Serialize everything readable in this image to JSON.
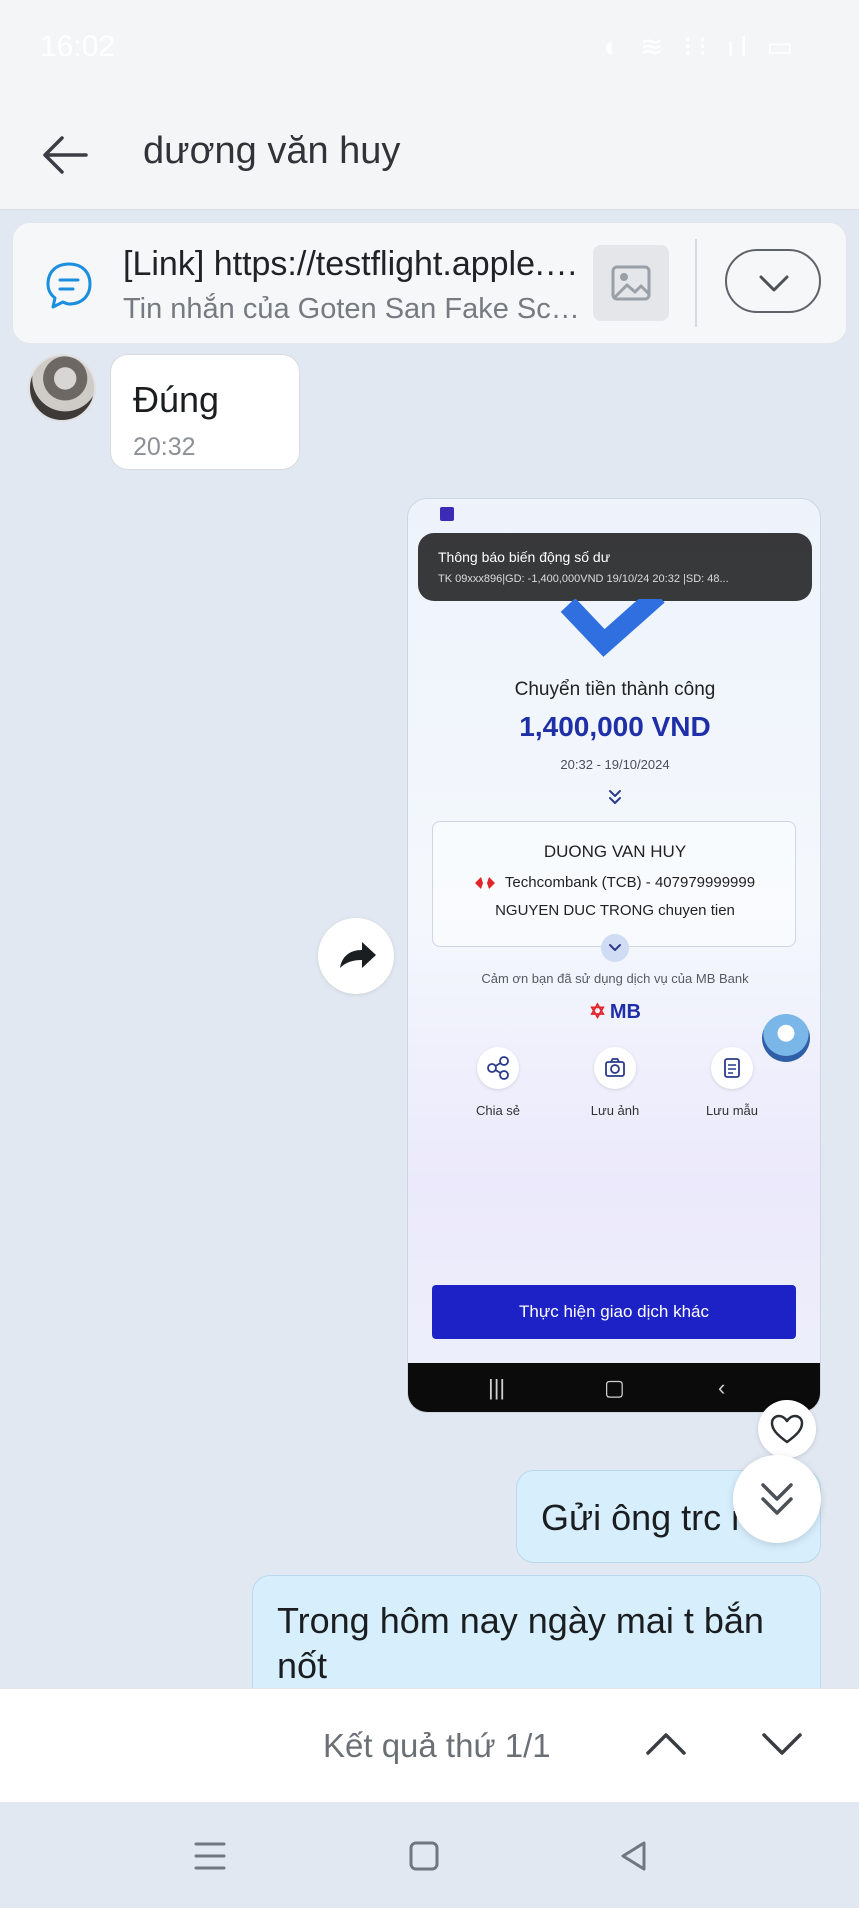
{
  "status_bar": {
    "time": "16:02",
    "icons": "◐ ≋ ⁝⁝ ıl ▭"
  },
  "header": {
    "title": "dương văn huy"
  },
  "pinned": {
    "title": "[Link] https://testflight.apple.com/join/...",
    "subtitle": "Tin nhắn của Goten San Fake Scam Bill"
  },
  "messages": [
    {
      "text": "Đúng",
      "time": "20:32"
    },
    {
      "text": "Gửi ông trc nhé"
    },
    {
      "text": "Trong hôm nay ngày mai t bắn nốt"
    }
  ],
  "screenshot": {
    "notification_title": "Thông báo biến động số dư",
    "notification_body": "TK 09xxx896|GD: -1,400,000VND 19/10/24 20:32 |SD: 48...",
    "success_text": "Chuyển tiền thành công",
    "amount": "1,400,000 VND",
    "datetime": "20:32 - 19/10/2024",
    "recipient_name": "DUONG VAN HUY",
    "bank_line": "Techcombank (TCB) - 407979999999",
    "memo": "NGUYEN DUC TRONG chuyen tien",
    "thanks": "Cảm ơn bạn đã sử dụng dịch vụ của MB Bank",
    "brand": "MB",
    "actions": [
      "Chia sẻ",
      "Lưu ảnh",
      "Lưu mẫu"
    ],
    "cta": "Thực hiện giao dịch khác"
  },
  "search": {
    "result": "Kết quả thứ 1/1"
  },
  "icons": [
    "back-arrow-icon",
    "message-icon",
    "image-icon",
    "chevron-down-icon",
    "share-forward-icon",
    "heart-icon",
    "double-chevron-down-icon",
    "chevron-up-icon",
    "menu-icon",
    "home-icon",
    "back-triangle-icon"
  ],
  "colors": {
    "accent": "#1f2fa8",
    "bubble_out": "#d7effd",
    "mb_button": "#1d22c7",
    "background": "#e2e8f1"
  }
}
